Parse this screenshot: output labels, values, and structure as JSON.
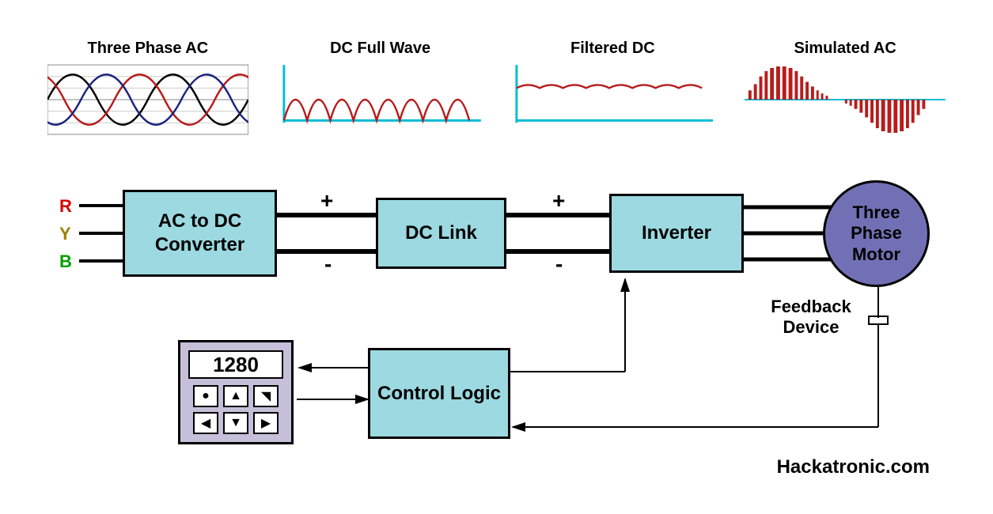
{
  "waveforms": {
    "three_phase": "Three Phase AC",
    "dc_full_wave": "DC Full Wave",
    "filtered_dc": "Filtered DC",
    "simulated_ac": "Simulated AC"
  },
  "phases": {
    "r": "R",
    "y": "Y",
    "b": "B"
  },
  "blocks": {
    "ac_dc_converter": "AC to DC Converter",
    "dc_link": "DC Link",
    "inverter": "Inverter",
    "control_logic": "Control Logic",
    "motor": "Three Phase Motor"
  },
  "polarity": {
    "plus": "+",
    "minus": "-"
  },
  "keypad": {
    "display_value": "1280"
  },
  "labels": {
    "feedback_device": "Feedback Device"
  },
  "attribution": "Hackatronic.com",
  "colors": {
    "block_fill": "#9cd9e0",
    "motor_fill": "#7270b5",
    "keypad_fill": "#c5bfd9",
    "phase_r": "#d80000",
    "phase_y": "#a08000",
    "phase_b": "#00a000",
    "wave_red": "#b71c1c",
    "wave_blue": "#1a237e",
    "wave_cyan": "#00bcd4"
  }
}
